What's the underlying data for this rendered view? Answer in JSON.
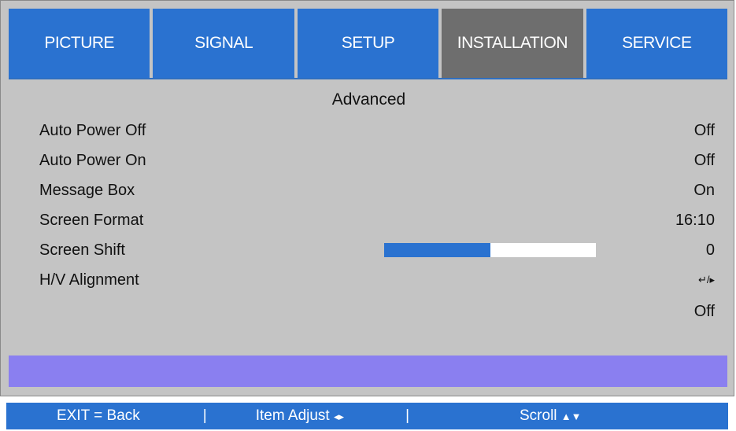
{
  "tabs": [
    {
      "label": "PICTURE",
      "active": false
    },
    {
      "label": "SIGNAL",
      "active": false
    },
    {
      "label": "SETUP",
      "active": false
    },
    {
      "label": "INSTALLATION",
      "active": true
    },
    {
      "label": "SERVICE",
      "active": false
    }
  ],
  "colors": {
    "tab_inactive": "#2a72d0",
    "tab_active": "#6e6e6e",
    "panel_bg": "#c4c4c4",
    "slider_fill": "#2a72d0",
    "highlight_band": "#8a7ff0"
  },
  "section_title": "Advanced",
  "rows": [
    {
      "label": "Auto Power Off",
      "value": "Off"
    },
    {
      "label": "Auto Power On",
      "value": "Off"
    },
    {
      "label": "Message Box",
      "value": "On"
    },
    {
      "label": "Screen Format",
      "value": "16:10"
    },
    {
      "label": "Screen Shift",
      "value": "0",
      "slider_fraction": 0.5
    },
    {
      "label": "H/V Alignment",
      "value": "↵/▸"
    },
    {
      "label": "",
      "value": "Off"
    }
  ],
  "footer": {
    "exit": "EXIT = Back",
    "sep1": "|",
    "item_adjust": "Item Adjust",
    "item_adjust_icon": "◂▸",
    "sep2": "|",
    "scroll": "Scroll",
    "scroll_icon": "▲▼"
  }
}
